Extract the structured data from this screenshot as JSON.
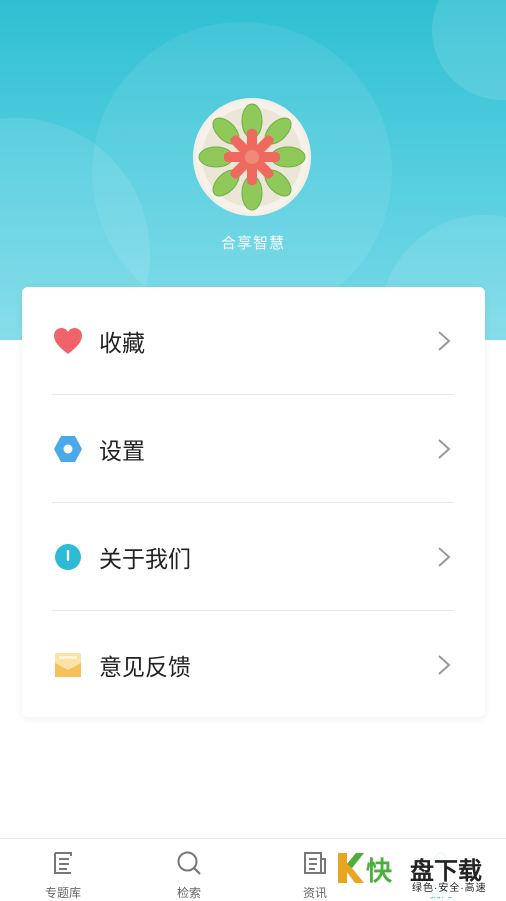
{
  "profile": {
    "username": "合享智慧",
    "avatar_icon": "dumpling-plate-avatar"
  },
  "menu": [
    {
      "label": "收藏",
      "icon": "heart-icon",
      "color": "#f0636b"
    },
    {
      "label": "设置",
      "icon": "hexagon-settings-icon",
      "color": "#4aa9e9"
    },
    {
      "label": "关于我们",
      "icon": "info-circle-icon",
      "color": "#2fbad6"
    },
    {
      "label": "意见反馈",
      "icon": "envelope-feedback-icon",
      "color": "#f5c15a"
    }
  ],
  "tabs": [
    {
      "label": "专题库",
      "icon": "topic-list-icon"
    },
    {
      "label": "检索",
      "icon": "search-icon"
    },
    {
      "label": "资讯",
      "icon": "news-icon"
    },
    {
      "label": "我的",
      "icon": "user-icon",
      "active": true
    }
  ],
  "watermark": {
    "brand_k": "K",
    "brand_fast": "快",
    "brand_name": "盘下载",
    "slogan": "绿色·安全·高速"
  },
  "colors": {
    "header_top": "#2fbfd3",
    "header_bottom": "#7ad9e7",
    "active_tab": "#3ab7cc"
  }
}
